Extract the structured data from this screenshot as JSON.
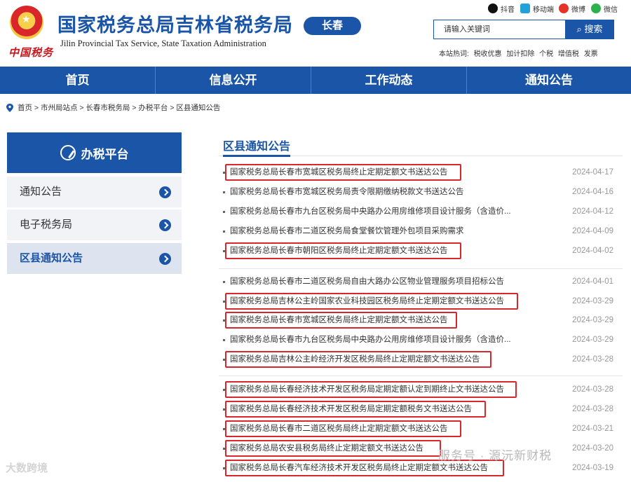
{
  "header": {
    "calligraphy": "中国税务",
    "title_cn": "国家税务总局吉林省税务局",
    "title_en": "Jilin Provincial Tax Service, State Taxation Administration",
    "city": "长春",
    "social": [
      "抖音",
      "移动端",
      "微博",
      "微信"
    ],
    "search_placeholder": "请输入关键词",
    "search_button": "搜索",
    "hot_label": "本站热词:",
    "hot_words": [
      "税收优惠",
      "加计扣除",
      "个税",
      "增值税",
      "发票"
    ]
  },
  "nav": [
    "首页",
    "信息公开",
    "工作动态",
    "通知公告"
  ],
  "breadcrumb": "首页 > 市州局站点 > 长春市税务局 > 办税平台 > 区县通知公告",
  "sidebar": {
    "title": "办税平台",
    "items": [
      "通知公告",
      "电子税务局",
      "区县通知公告"
    ]
  },
  "main": {
    "title": "区县通知公告",
    "rows": [
      {
        "text": "国家税务总局长春市宽城区税务局终止定期定额文书送达公告",
        "date": "2024-04-17"
      },
      {
        "text": "国家税务总局长春市宽城区税务局责令限期缴纳税款文书送达公告",
        "date": "2024-04-16"
      },
      {
        "text": "国家税务总局长春市九台区税务局中央路办公用房维修项目设计服务（含造价...",
        "date": "2024-04-12"
      },
      {
        "text": "国家税务总局长春市二道区税务局食堂餐饮管理外包项目采购需求",
        "date": "2024-04-09"
      },
      {
        "text": "国家税务总局长春市朝阳区税务局终止定期定额文书送达公告",
        "date": "2024-04-02"
      },
      {
        "text": "国家税务总局长春市二道区税务局自由大路办公区物业管理服务项目招标公告",
        "date": "2024-04-01"
      },
      {
        "text": "国家税务总局吉林公主岭国家农业科技园区税务局终止定期定额文书送达公告",
        "date": "2024-03-29"
      },
      {
        "text": "国家税务总局长春市宽城区税务局终止定期定额文书送达公告",
        "date": "2024-03-29"
      },
      {
        "text": "国家税务总局长春市九台区税务局中央路办公用房维修项目设计服务（含造价...",
        "date": "2024-03-29"
      },
      {
        "text": "国家税务总局吉林公主岭经济开发区税务局终止定期定额文书送达公告",
        "date": "2024-03-28"
      },
      {
        "text": "国家税务总局长春经济技术开发区税务局定期定额认定到期终止文书送达公告",
        "date": "2024-03-28"
      },
      {
        "text": "国家税务总局长春经济技术开发区税务局定期定额税务文书送达公告",
        "date": "2024-03-28"
      },
      {
        "text": "国家税务总局长春市二道区税务局终止定期定额文书送达公告",
        "date": "2024-03-21"
      },
      {
        "text": "国家税务总局农安县税务局终止定期定额文书送达公告",
        "date": "2024-03-20"
      },
      {
        "text": "国家税务总局长春汽车经济技术开发区税务局终止定期定额文书送达公告",
        "date": "2024-03-19"
      }
    ]
  },
  "watermarks": {
    "left": "大数跨境",
    "right": "服务号 · 源沅新财税"
  }
}
